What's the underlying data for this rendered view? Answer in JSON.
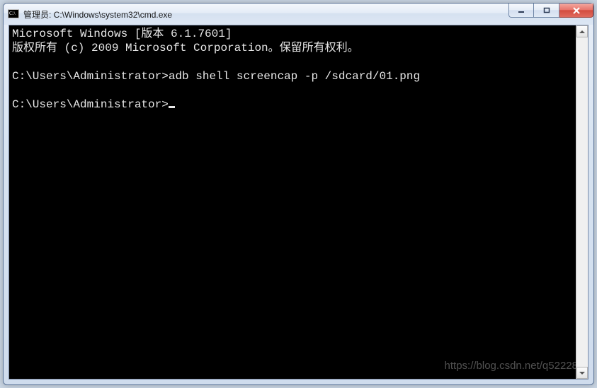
{
  "window": {
    "title": "管理员: C:\\Windows\\system32\\cmd.exe",
    "icon": "cmd-icon",
    "buttons": {
      "minimize": "minimize",
      "maximize": "maximize",
      "close": "close"
    }
  },
  "terminal": {
    "line1": "Microsoft Windows [版本 6.1.7601]",
    "line2": "版权所有 (c) 2009 Microsoft Corporation。保留所有权利。",
    "blank1": "",
    "prompt1": "C:\\Users\\Administrator>",
    "command1": "adb shell screencap -p /sdcard/01.png",
    "blank2": "",
    "prompt2": "C:\\Users\\Administrator>"
  },
  "watermark": "https://blog.csdn.net/q52228"
}
